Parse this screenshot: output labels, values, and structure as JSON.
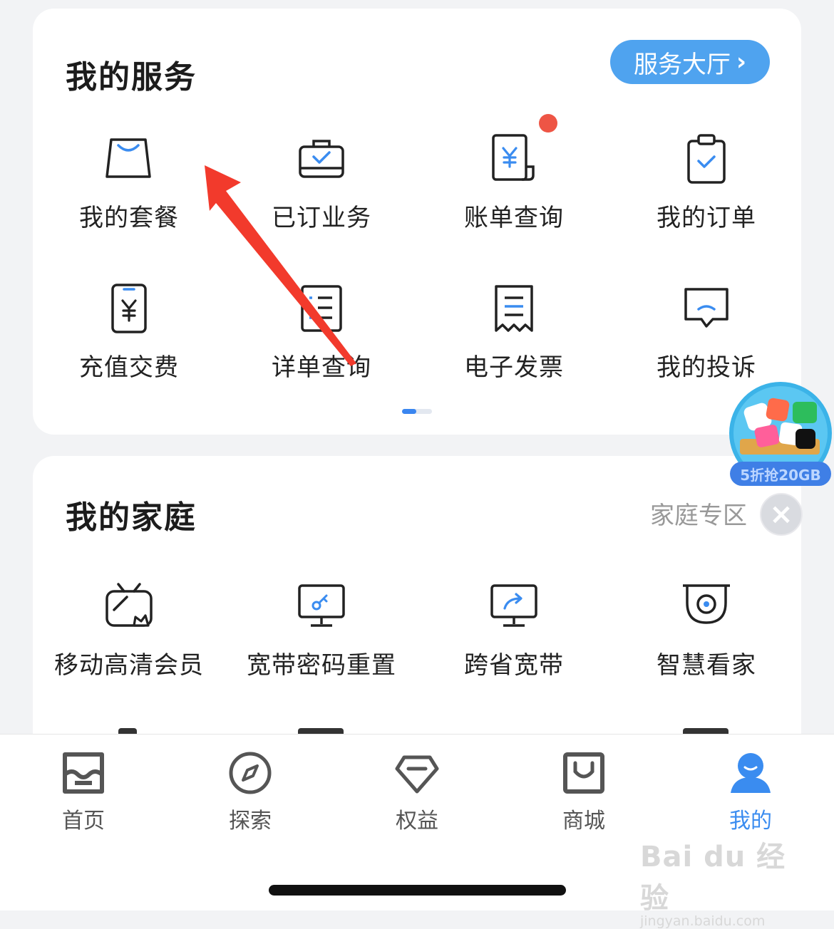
{
  "services": {
    "title": "我的服务",
    "hall_button": "服务大厅",
    "items": [
      {
        "label": "我的套餐",
        "icon": "shopping-bag-icon"
      },
      {
        "label": "已订业务",
        "icon": "briefcase-check-icon"
      },
      {
        "label": "账单查询",
        "icon": "bill-yuan-icon",
        "badge": true
      },
      {
        "label": "我的订单",
        "icon": "clipboard-check-icon"
      },
      {
        "label": "充值交费",
        "icon": "phone-yuan-icon"
      },
      {
        "label": "详单查询",
        "icon": "list-document-icon"
      },
      {
        "label": "电子发票",
        "icon": "receipt-icon"
      },
      {
        "label": "我的投诉",
        "icon": "chat-bubble-icon"
      }
    ]
  },
  "family": {
    "title": "我的家庭",
    "zone_link": "家庭专区",
    "items": [
      {
        "label": "移动高清会员",
        "icon": "tv-crown-icon"
      },
      {
        "label": "宽带密码重置",
        "icon": "monitor-key-icon"
      },
      {
        "label": "跨省宽带",
        "icon": "monitor-share-icon"
      },
      {
        "label": "智慧看家",
        "icon": "camera-icon"
      }
    ]
  },
  "promo": {
    "label": "5折抢20GB"
  },
  "tabbar": {
    "tabs": [
      {
        "label": "首页",
        "icon": "store-icon"
      },
      {
        "label": "探索",
        "icon": "compass-icon"
      },
      {
        "label": "权益",
        "icon": "diamond-icon"
      },
      {
        "label": "商城",
        "icon": "shopping-bag-icon"
      },
      {
        "label": "我的",
        "icon": "user-icon",
        "active": true
      }
    ]
  },
  "watermark": {
    "main": "Bai du 经验",
    "sub": "jingyan.baidu.com"
  },
  "colors": {
    "accent": "#4fa3ef",
    "active_tab": "#3a8cf0",
    "badge": "#ee5545",
    "annotation_arrow": "#f23a2c"
  }
}
